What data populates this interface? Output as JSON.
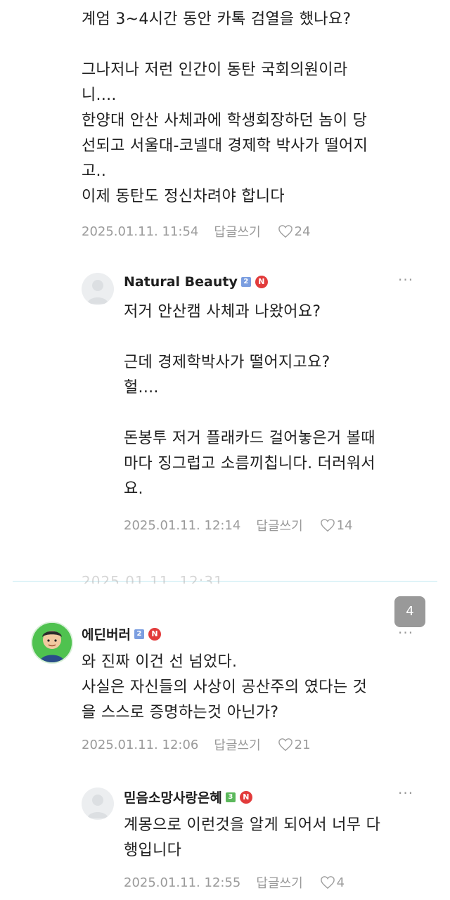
{
  "top_cut_text": "",
  "comment1": {
    "lines": [
      "계엄 3~4시간 동안 카톡 검열을 했나요?",
      "",
      "그나저나 저런 인간이 동탄 국회의원이라",
      "니....",
      "한양대 안산 사체과에 학생회장하던 놈이 당",
      "선되고 서울대-코넬대 경제학 박사가 떨어지",
      "고..",
      "이제 동탄도 정신차려야 합니다"
    ],
    "date": "2025.01.11. 11:54",
    "reply_label": "답글쓰기",
    "likes": "24"
  },
  "reply1": {
    "author": "Natural Beauty",
    "grade": "2",
    "badge": "N",
    "more": "···",
    "lines": [
      "저거 안산캠 사체과 나왔어요?",
      "",
      "근데 경제학박사가 떨어지고요?",
      "헐....",
      "",
      "돈봉투 저거 플래카드 걸어놓은거 볼때",
      "마다 징그럽고 소름끼칩니다. 더러워서",
      "요."
    ],
    "date": "2025.01.11. 12:14",
    "reply_label": "답글쓰기",
    "likes": "14"
  },
  "ghost_text": "2025.01.11. 12:31",
  "page_badge": "4",
  "comment2": {
    "author": "에딘버러",
    "grade": "2",
    "badge": "N",
    "more": "···",
    "lines": [
      "와 진짜 이건 선 넘었다.",
      "사실은 자신들의 사상이 공산주의 였다는 것",
      "을 스스로 증명하는것 아닌가?"
    ],
    "date": "2025.01.11. 12:06",
    "reply_label": "답글쓰기",
    "likes": "21"
  },
  "reply2": {
    "author": "믿음소망사랑은혜",
    "grade": "3",
    "badge": "N",
    "more": "···",
    "lines": [
      "계몽으로 이런것을 알게 되어서 너무 다",
      "행입니다"
    ],
    "date": "2025.01.11. 12:55",
    "reply_label": "답글쓰기",
    "likes": "4"
  },
  "colors": {
    "meta_gray": "#9a9a9a",
    "badge_red": "#e23b3b",
    "grade_blue": "#7b9ee0",
    "grade_green": "#5bb85b"
  }
}
